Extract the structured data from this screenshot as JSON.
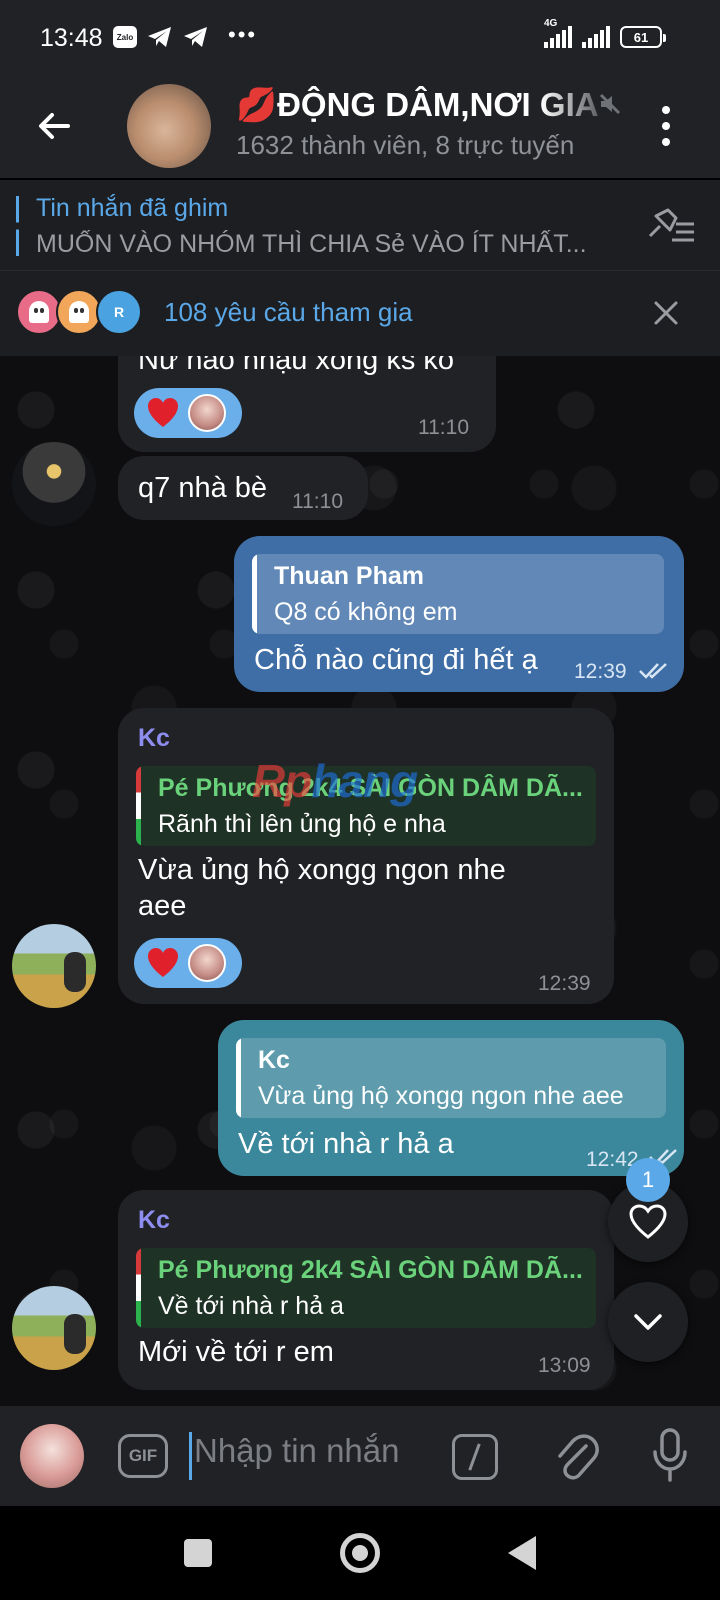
{
  "status_bar": {
    "time": "13:48",
    "zalo_label": "Zalo",
    "dots": "•••",
    "network": "4G",
    "battery": "61"
  },
  "header": {
    "title": "💋ĐỘNG DÂM,NƠI GIA",
    "subtitle": "1632 thành viên, 8 trực tuyến"
  },
  "pinned": {
    "title": "Tin nhắn đã ghim",
    "text": "MUỐN VÀO NHÓM THÌ CHIA Sẻ VÀO ÍT NHẤT..."
  },
  "join_requests": {
    "label": "108 yêu cầu tham gia",
    "third_initial": "R"
  },
  "messages": [
    {
      "text": "Nư nào nhậu xong ks ko",
      "time": "11:10",
      "reactions": [
        "heart"
      ]
    },
    {
      "text": "q7 nhà bè",
      "time": "11:10"
    },
    {
      "reply_name": "Thuan Pham",
      "reply_text": "Q8 có không em",
      "text": "Chỗ nào cũng đi hết ạ",
      "time": "12:39"
    },
    {
      "sender": "Kc",
      "reply_name": "Pé Phương 2k4 SÀI GÒN DÂM DÃ...",
      "reply_text": "Rãnh thì lên ủng hộ e nha",
      "text_line1": "Vừa ủng hộ xongg ngon nhe",
      "text_line2": "aee",
      "time": "12:39",
      "reactions": [
        "heart"
      ]
    },
    {
      "reply_name": "Kc",
      "reply_text": "Vừa ủng hộ xongg ngon nhe aee",
      "text": "Về tới nhà r hả a",
      "time": "12:42"
    },
    {
      "sender": "Kc",
      "reply_name": "Pé Phương 2k4 SÀI GÒN DÂM DÃ...",
      "reply_text": "Về tới nhà r hả a",
      "text": "Mới về tới r em",
      "time": "13:09"
    }
  ],
  "watermark": {
    "part1": "Rp",
    "part2": "hang"
  },
  "fab": {
    "reaction_count": "1"
  },
  "input": {
    "gif_label": "GIF",
    "placeholder": "Nhập tin nhắn"
  },
  "colors": {
    "accent": "#5aa8e8",
    "outgoing": "#3f6ea6",
    "incoming": "#212226",
    "reply_name_green": "#6ad27a",
    "sender_purple": "#8e8df0"
  }
}
